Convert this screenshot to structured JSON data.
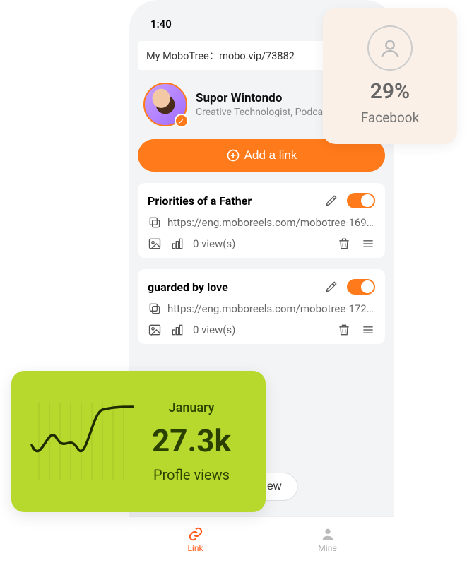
{
  "status": {
    "time": "1:40"
  },
  "profile": {
    "url_label": "My MoboTree：mobo.vip/73882",
    "name": "Supor Wintondo",
    "role": "Creative Technologist, Podcaster"
  },
  "buttons": {
    "add_link": "Add a link",
    "preview": "Preview"
  },
  "links": [
    {
      "title": "Priorities of a Father",
      "url": "https://eng.moboreels.com/mobotree-16995…",
      "views": "0 view(s)"
    },
    {
      "title": "guarded by love",
      "url": "https://eng.moboreels.com/mobotree-17228…",
      "views": "0 view(s)"
    }
  ],
  "tabs": {
    "link": "Link",
    "mine": "Mine"
  },
  "source_card": {
    "percent": "29%",
    "name": "Facebook"
  },
  "stats_card": {
    "month": "January",
    "value": "27.3k",
    "label": "Profle views"
  },
  "chart_data": {
    "type": "line",
    "title": "Profile views — January",
    "x": [
      1,
      2,
      3,
      4,
      5,
      6,
      7,
      8,
      9,
      10
    ],
    "values": [
      55,
      30,
      65,
      30,
      50,
      35,
      75,
      90,
      92,
      93
    ],
    "ylim": [
      0,
      100
    ],
    "xlabel": "",
    "ylabel": ""
  }
}
